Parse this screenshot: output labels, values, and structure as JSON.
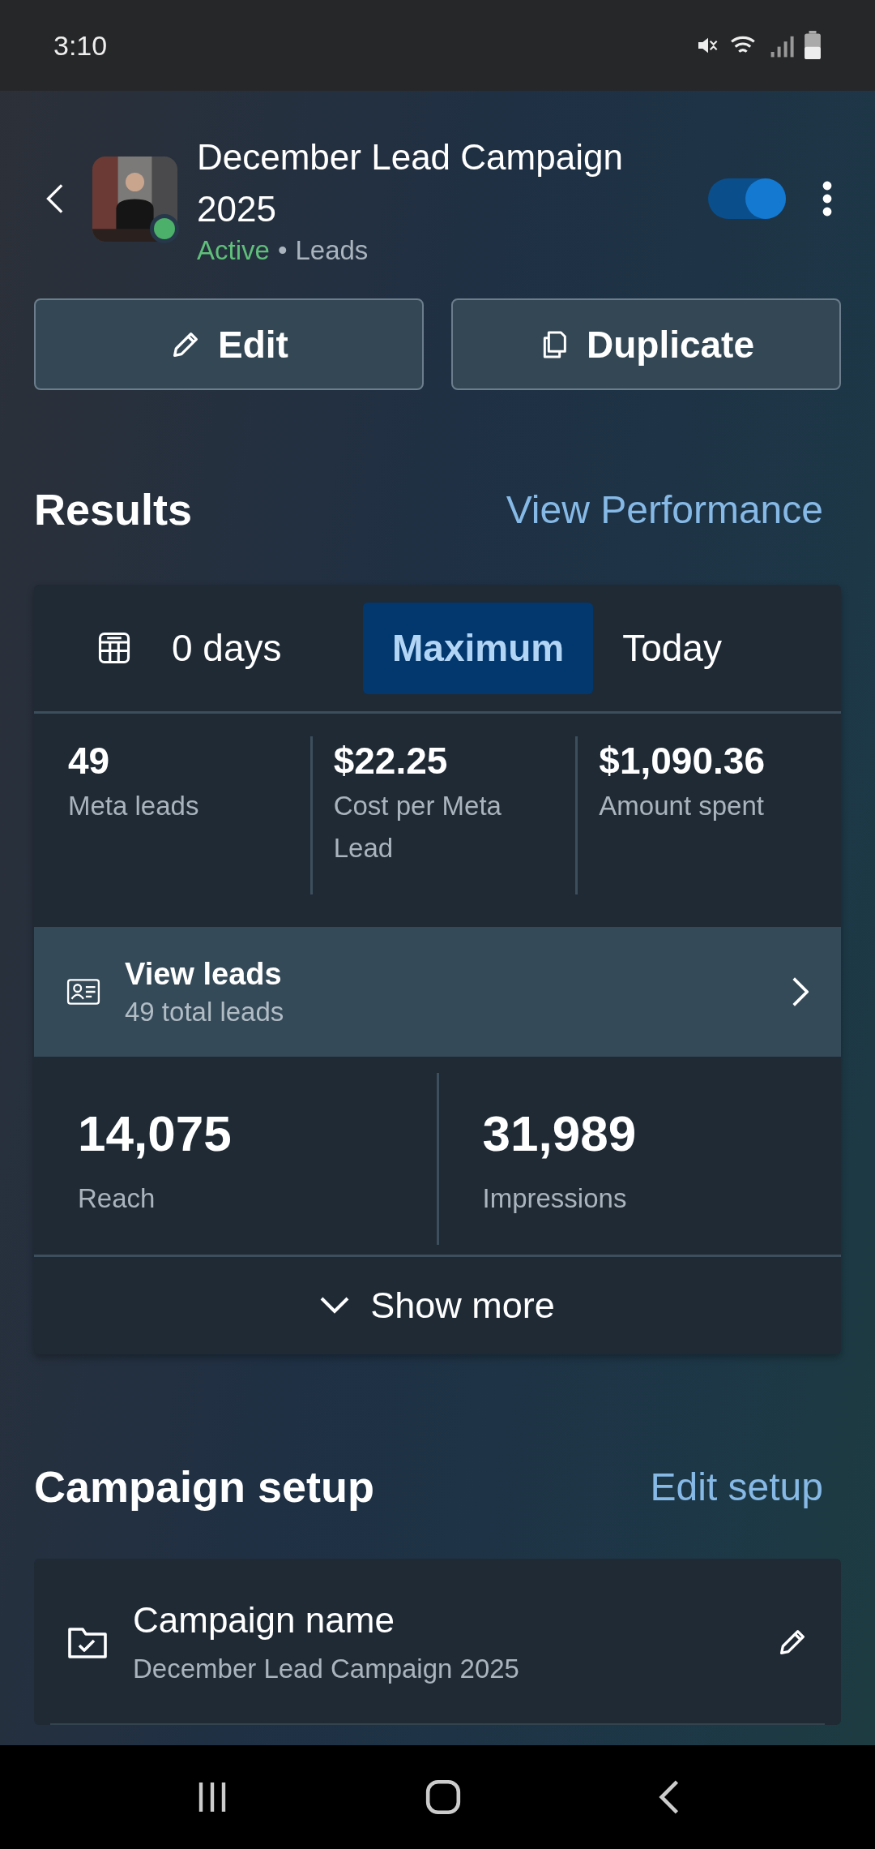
{
  "status_bar": {
    "time": "3:10"
  },
  "header": {
    "title": "December Lead Campaign 2025",
    "status": "Active",
    "separator": "•",
    "objective": "Leads",
    "campaign_on": true,
    "avatar": {
      "kind": "picture",
      "online": true
    }
  },
  "actions": [
    {
      "label": "Edit"
    },
    {
      "label": "Duplicate"
    }
  ],
  "results": {
    "title": "Results",
    "link": "View Performance",
    "ranges": [
      {
        "label": "0 days",
        "selected": false
      },
      {
        "label": "Maximum",
        "selected": true
      },
      {
        "label": "Today",
        "selected": false
      }
    ],
    "metrics": [
      {
        "value": "49",
        "label": "Meta leads"
      },
      {
        "value": "$22.25",
        "label": "Cost per Meta Lead"
      },
      {
        "value": "$1,090.36",
        "label": "Amount spent"
      }
    ],
    "view_leads": {
      "title": "View leads",
      "subtitle": "49 total leads"
    },
    "reach_metrics": [
      {
        "value": "14,075",
        "label": "Reach"
      },
      {
        "value": "31,989",
        "label": "Impressions"
      }
    ],
    "show_more": "Show more"
  },
  "setup": {
    "title": "Campaign setup",
    "link": "Edit setup",
    "fields": [
      {
        "label": "Campaign name",
        "value": "December Lead Campaign 2025"
      }
    ]
  }
}
